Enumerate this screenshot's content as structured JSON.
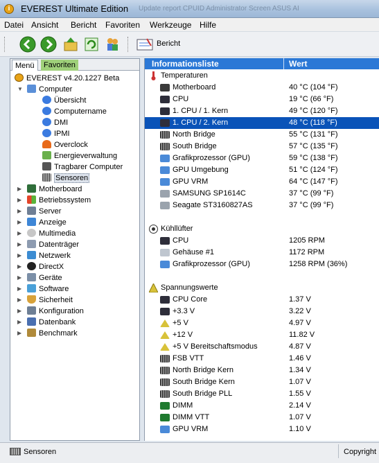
{
  "window": {
    "title": "EVEREST Ultimate Edition",
    "background_tabs": "Update report   CPUID   Administrator Screen   ASUS AI"
  },
  "menu": [
    "Datei",
    "Ansicht",
    "Bericht",
    "Favoriten",
    "Werkzeuge",
    "Hilfe"
  ],
  "toolbar": {
    "report_label": "Bericht"
  },
  "left_panel": {
    "tabs": [
      "Menü",
      "Favoriten"
    ],
    "tree": [
      {
        "label": "EVEREST v4.20.1227 Beta",
        "level": 0,
        "icon": "everest-icon"
      },
      {
        "label": "Computer",
        "level": 1,
        "icon": "computer-icon",
        "expanded": true
      },
      {
        "label": "Übersicht",
        "level": 2,
        "icon": "info-icon"
      },
      {
        "label": "Computername",
        "level": 2,
        "icon": "info-icon"
      },
      {
        "label": "DMI",
        "level": 2,
        "icon": "info-icon"
      },
      {
        "label": "IPMI",
        "level": 2,
        "icon": "info-icon"
      },
      {
        "label": "Overclock",
        "level": 2,
        "icon": "flame-icon"
      },
      {
        "label": "Energieverwaltung",
        "level": 2,
        "icon": "power-icon"
      },
      {
        "label": "Tragbarer Computer",
        "level": 2,
        "icon": "laptop-icon"
      },
      {
        "label": "Sensoren",
        "level": 2,
        "icon": "sensor-icon",
        "selected": true
      },
      {
        "label": "Motherboard",
        "level": 1,
        "icon": "motherboard-icon"
      },
      {
        "label": "Betriebssystem",
        "level": 1,
        "icon": "windows-icon"
      },
      {
        "label": "Server",
        "level": 1,
        "icon": "server-icon"
      },
      {
        "label": "Anzeige",
        "level": 1,
        "icon": "display-icon"
      },
      {
        "label": "Multimedia",
        "level": 1,
        "icon": "multimedia-icon"
      },
      {
        "label": "Datenträger",
        "level": 1,
        "icon": "disk-icon"
      },
      {
        "label": "Netzwerk",
        "level": 1,
        "icon": "network-icon"
      },
      {
        "label": "DirectX",
        "level": 1,
        "icon": "directx-icon"
      },
      {
        "label": "Geräte",
        "level": 1,
        "icon": "devices-icon"
      },
      {
        "label": "Software",
        "level": 1,
        "icon": "software-icon"
      },
      {
        "label": "Sicherheit",
        "level": 1,
        "icon": "shield-icon"
      },
      {
        "label": "Konfiguration",
        "level": 1,
        "icon": "config-icon"
      },
      {
        "label": "Datenbank",
        "level": 1,
        "icon": "database-icon"
      },
      {
        "label": "Benchmark",
        "level": 1,
        "icon": "hourglass-icon"
      }
    ]
  },
  "right_panel": {
    "columns": [
      "Informationsliste",
      "Wert"
    ],
    "groups": [
      {
        "name": "Temperaturen",
        "icon": "thermometer-icon",
        "rows": [
          {
            "name": "Motherboard",
            "value": "40 °C  (104 °F)",
            "icon": "motherboard-icon"
          },
          {
            "name": "CPU",
            "value": "19 °C  (66 °F)",
            "icon": "cpu-icon"
          },
          {
            "name": "1. CPU / 1. Kern",
            "value": "49 °C  (120 °F)",
            "icon": "cpu-icon"
          },
          {
            "name": "1. CPU / 2. Kern",
            "value": "48 °C  (118 °F)",
            "icon": "cpu-icon",
            "selected": true
          },
          {
            "name": "North Bridge",
            "value": "55 °C  (131 °F)",
            "icon": "chip-icon"
          },
          {
            "name": "South Bridge",
            "value": "57 °C  (135 °F)",
            "icon": "chip-icon"
          },
          {
            "name": "Grafikprozessor (GPU)",
            "value": "59 °C  (138 °F)",
            "icon": "gpu-icon"
          },
          {
            "name": "GPU Umgebung",
            "value": "51 °C  (124 °F)",
            "icon": "gpu-icon"
          },
          {
            "name": "GPU VRM",
            "value": "64 °C  (147 °F)",
            "icon": "gpu-icon"
          },
          {
            "name": "SAMSUNG SP1614C",
            "value": "37 °C  (99 °F)",
            "icon": "hdd-icon"
          },
          {
            "name": "Seagate ST3160827AS",
            "value": "37 °C  (99 °F)",
            "icon": "hdd-icon"
          }
        ]
      },
      {
        "name": "Kühllüfter",
        "icon": "fan-icon",
        "rows": [
          {
            "name": "CPU",
            "value": "1205 RPM",
            "icon": "cpu-icon"
          },
          {
            "name": "Gehäuse #1",
            "value": "1172 RPM",
            "icon": "case-icon"
          },
          {
            "name": "Grafikprozessor (GPU)",
            "value": "1258 RPM  (36%)",
            "icon": "gpu-icon"
          }
        ]
      },
      {
        "name": "Spannungswerte",
        "icon": "voltage-icon",
        "rows": [
          {
            "name": "CPU Core",
            "value": "1.37 V",
            "icon": "cpu-icon"
          },
          {
            "name": "+3.3 V",
            "value": "3.22 V",
            "icon": "cpu-icon"
          },
          {
            "name": "+5 V",
            "value": "4.97 V",
            "icon": "voltage-icon"
          },
          {
            "name": "+12 V",
            "value": "11.82 V",
            "icon": "voltage-icon"
          },
          {
            "name": "+5 V Bereitschaftsmodus",
            "value": "4.87 V",
            "icon": "voltage-icon"
          },
          {
            "name": "FSB VTT",
            "value": "1.46 V",
            "icon": "chip-icon"
          },
          {
            "name": "North Bridge Kern",
            "value": "1.34 V",
            "icon": "chip-icon"
          },
          {
            "name": "South Bridge Kern",
            "value": "1.07 V",
            "icon": "chip-icon"
          },
          {
            "name": "South Bridge PLL",
            "value": "1.55 V",
            "icon": "chip-icon"
          },
          {
            "name": "DIMM",
            "value": "2.14 V",
            "icon": "ram-icon"
          },
          {
            "name": "DIMM VTT",
            "value": "1.07 V",
            "icon": "ram-icon"
          },
          {
            "name": "GPU VRM",
            "value": "1.10 V",
            "icon": "gpu-icon"
          }
        ]
      }
    ]
  },
  "status": {
    "left": "Sensoren",
    "right": "Copyright"
  },
  "colors": {
    "selection": "#0a53b8",
    "header": "#2b78d6",
    "favoriten_tab": "#9fd07a"
  }
}
